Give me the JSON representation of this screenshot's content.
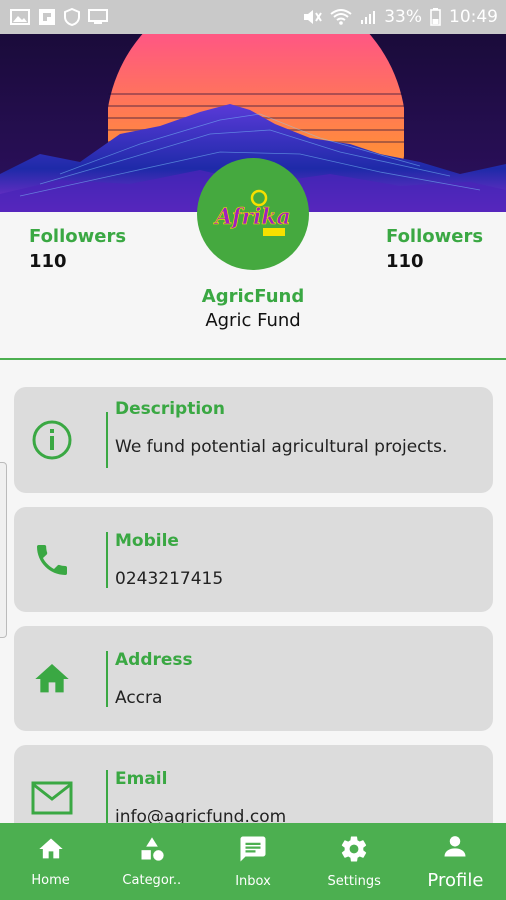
{
  "status_bar": {
    "battery": "33%",
    "time": "10:49",
    "icons": [
      "image-icon",
      "flipboard-icon",
      "shield-icon",
      "monitor-icon",
      "mute-icon",
      "wifi-icon",
      "signal-icon",
      "battery-icon"
    ]
  },
  "profile": {
    "followers_left_label": "Followers",
    "followers_left_value": "110",
    "followers_right_label": "Followers",
    "followers_right_value": "110",
    "handle": "AgricFund",
    "name": "Agric Fund",
    "logo_text": "Afrika"
  },
  "cards": [
    {
      "icon": "info-icon",
      "title": "Description",
      "value": "We fund potential agricultural projects."
    },
    {
      "icon": "phone-icon",
      "title": "Mobile",
      "value": "0243217415"
    },
    {
      "icon": "home-icon",
      "title": "Address",
      "value": "Accra"
    },
    {
      "icon": "mail-icon",
      "title": "Email",
      "value": "info@agricfund.com"
    }
  ],
  "nav": [
    {
      "icon": "home-icon",
      "label": "Home"
    },
    {
      "icon": "categories-icon",
      "label": "Categor.."
    },
    {
      "icon": "inbox-icon",
      "label": "Inbox"
    },
    {
      "icon": "settings-icon",
      "label": "Settings"
    },
    {
      "icon": "profile-icon",
      "label": "Profile",
      "active": true
    }
  ],
  "colors": {
    "accent": "#3aa843",
    "nav_bg": "#4caf50",
    "card_bg": "#dcdcdc"
  }
}
